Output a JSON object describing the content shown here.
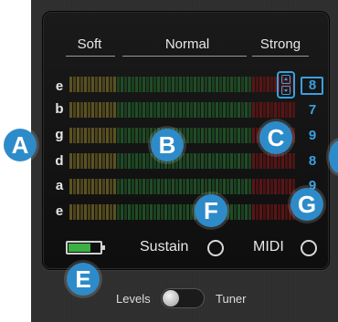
{
  "headers": {
    "soft": "Soft",
    "normal": "Normal",
    "strong": "Strong"
  },
  "strings": [
    {
      "name": "e",
      "threshold": "8"
    },
    {
      "name": "b",
      "threshold": "7"
    },
    {
      "name": "g",
      "threshold": "9"
    },
    {
      "name": "d",
      "threshold": "8"
    },
    {
      "name": "a",
      "threshold": "9"
    },
    {
      "name": "e",
      "threshold": ""
    }
  ],
  "callouts": {
    "a": "A",
    "b": "B",
    "c": "C",
    "e": "E",
    "f": "F",
    "g": "G"
  },
  "controls": {
    "sustain": "Sustain",
    "midi": "MIDI",
    "levels": "Levels",
    "tuner": "Tuner"
  },
  "colors": {
    "accent": "#3aa0df",
    "callout": "#2e8bc9",
    "battery": "#3cb043",
    "soft_zone": "#5c5220",
    "normal_zone": "#1f4d24",
    "strong_zone": "#5a1515"
  },
  "icons": {
    "spinner": "up-down-stepper-icon",
    "battery": "battery-icon",
    "toggle": "levels-tuner-switch"
  }
}
